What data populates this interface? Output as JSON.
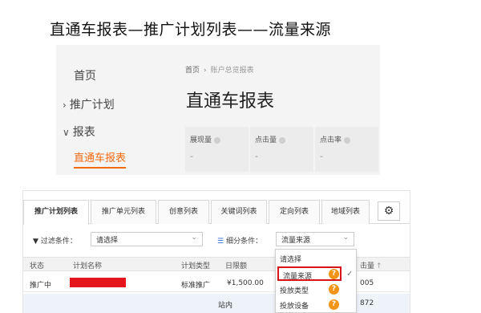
{
  "slide": {
    "title": "直通车报表—推广计划列表——流量来源"
  },
  "sidebar": {
    "home": "首页",
    "plan": "推广计划",
    "report": "报表",
    "sub_active": "直通车报表",
    "collapsed_chevron": "›",
    "expanded_chevron": "∨"
  },
  "header": {
    "breadcrumb_home": "首页",
    "breadcrumb_sep": "›",
    "breadcrumb_current": "账户总览报表",
    "page_title": "直通车报表"
  },
  "metrics": [
    {
      "label": "展现量",
      "value": "-"
    },
    {
      "label": "点击量",
      "value": "-"
    },
    {
      "label": "点击率",
      "value": "-"
    }
  ],
  "tabs": [
    "推广计划列表",
    "推广单元列表",
    "创意列表",
    "关键词列表",
    "定向列表",
    "地域列表"
  ],
  "toolbar": {
    "gear_icon": "⚙"
  },
  "filters": {
    "filter_label": "过滤条件：",
    "filter_value": "请选择",
    "split_label": "细分条件：",
    "split_value": "流量来源",
    "caret": "⌄"
  },
  "table": {
    "columns": [
      "状态",
      "计划名称",
      "计划类型",
      "日限额",
      "击量"
    ],
    "row": {
      "status": "推广中",
      "type": "标准推广",
      "daily_limit": "¥1,500.00",
      "clicks": "005"
    },
    "sub_row": {
      "source": "站内",
      "clicks": "872"
    }
  },
  "dropdown": {
    "items": [
      "请选择",
      "流量来源",
      "投放类型",
      "投放设备"
    ],
    "help_icon": "?",
    "check_icon": "✓"
  },
  "colors": {
    "accent_orange": "#f36a10",
    "highlight_red": "#d8141b",
    "help_orange": "#f29418"
  }
}
